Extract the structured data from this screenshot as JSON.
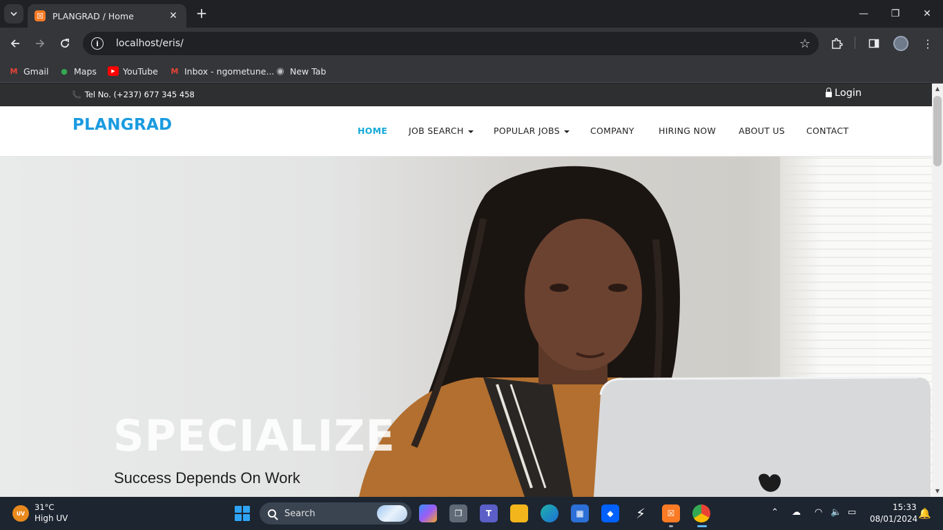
{
  "browser": {
    "tab_title": "PLANGRAD / Home",
    "tab_favicon_text": "☒",
    "url": "localhost/eris/",
    "bookmarks": [
      {
        "label": "Gmail",
        "icon": "gmail-icon",
        "color": "#ea4335",
        "glyph": "M"
      },
      {
        "label": "Maps",
        "icon": "maps-icon",
        "color": "#34a853",
        "glyph": "●"
      },
      {
        "label": "YouTube",
        "icon": "youtube-icon",
        "color": "#ff0000",
        "glyph": "▶"
      },
      {
        "label": "Inbox - ngometune...",
        "icon": "gmail-icon",
        "color": "#ea4335",
        "glyph": "M"
      },
      {
        "label": "New Tab",
        "icon": "globe-icon",
        "color": "#bdc1c6",
        "glyph": "◉"
      }
    ]
  },
  "site": {
    "phone_text": "Tel No. (+237) 677 345 458",
    "login_label": "Login",
    "brand": "PLANGRAD",
    "brand_color": "#1a9be0",
    "active_color": "#14a9d8",
    "nav": [
      {
        "label": "HOME",
        "active": true,
        "dropdown": false
      },
      {
        "label": "JOB SEARCH",
        "active": false,
        "dropdown": true
      },
      {
        "label": "POPULAR JOBS",
        "active": false,
        "dropdown": true
      },
      {
        "label": "COMPANY",
        "active": false,
        "dropdown": false
      },
      {
        "label": "HIRING NOW",
        "active": false,
        "dropdown": false
      },
      {
        "label": "ABOUT US",
        "active": false,
        "dropdown": false
      },
      {
        "label": "CONTACT",
        "active": false,
        "dropdown": false
      }
    ],
    "hero": {
      "title": "SPECIALIZE",
      "subtitle": "Success Depends On Work"
    }
  },
  "taskbar": {
    "weather_badge": "UV",
    "temperature": "31°C",
    "weather_desc": "High UV",
    "search_label": "Search",
    "time": "15:33",
    "date": "08/01/2024"
  }
}
